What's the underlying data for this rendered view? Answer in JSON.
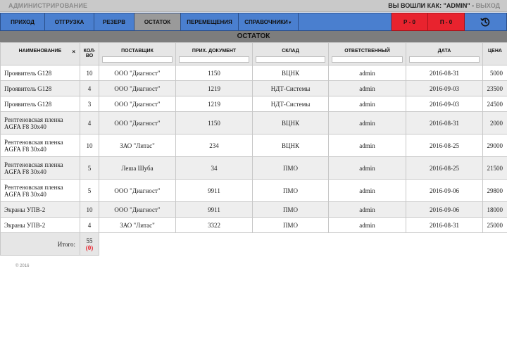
{
  "topbar": {
    "admin_link": "АДМИНИСТРИРОВАНИЕ",
    "login_prefix": "ВЫ ВОШЛИ КАК: \"ADMIN\"",
    "separator": " - ",
    "logout": "ВЫХОД"
  },
  "nav": {
    "items": [
      {
        "label": "ПРИХОД"
      },
      {
        "label": "ОТГРУЗКА"
      },
      {
        "label": "РЕЗЕРВ"
      },
      {
        "label": "ОСТАТОК"
      },
      {
        "label": "ПЕРЕМЕЩЕНИЯ"
      },
      {
        "label": "СПРАВОЧНИКИ"
      }
    ],
    "counter_r": "Р - 0",
    "counter_p": "П - 0",
    "history_icon": "history-icon",
    "active_color": "#9a9a9a",
    "nav_color": "#4a7fcf",
    "alert_color": "#e8232e"
  },
  "section_title": "ОСТАТОК",
  "table": {
    "headers": {
      "name": "НАИМЕНОВАНИЕ",
      "clear": "×",
      "qty": "КОЛ-ВО",
      "supplier": "ПОСТАВЩИК",
      "document": "ПРИХ. ДОКУМЕНТ",
      "warehouse": "СКЛАД",
      "responsible": "ОТВЕТСТВЕННЫЙ",
      "date": "ДАТА",
      "price": "ЦЕНА"
    },
    "rows": [
      {
        "name": "Проявитель G128",
        "qty": "10",
        "supplier": "ООО \"Диагност\"",
        "document": "1150",
        "warehouse": "ВЦНК",
        "responsible": "admin",
        "date": "2016-08-31",
        "price": "5000"
      },
      {
        "name": "Проявитель G128",
        "qty": "4",
        "supplier": "ООО \"Диагност\"",
        "document": "1219",
        "warehouse": "НДТ-Системы",
        "responsible": "admin",
        "date": "2016-09-03",
        "price": "23500"
      },
      {
        "name": "Проявитель G128",
        "qty": "3",
        "supplier": "ООО \"Диагност\"",
        "document": "1219",
        "warehouse": "НДТ-Системы",
        "responsible": "admin",
        "date": "2016-09-03",
        "price": "24500"
      },
      {
        "name": "Рентгеновская пленка AGFA F8 30x40",
        "qty": "4",
        "supplier": "ООО \"Диагност\"",
        "document": "1150",
        "warehouse": "ВЦНК",
        "responsible": "admin",
        "date": "2016-08-31",
        "price": "2000"
      },
      {
        "name": "Рентгеновская пленка AGFA F8 30x40",
        "qty": "10",
        "supplier": "ЗАО \"Литас\"",
        "document": "234",
        "warehouse": "ВЦНК",
        "responsible": "admin",
        "date": "2016-08-25",
        "price": "29000"
      },
      {
        "name": "Рентгеновская пленка AGFA F8 30x40",
        "qty": "5",
        "supplier": "Леша Шуба",
        "document": "34",
        "warehouse": "ПМО",
        "responsible": "admin",
        "date": "2016-08-25",
        "price": "21500"
      },
      {
        "name": "Рентгеновская пленка AGFA F8 30x40",
        "qty": "5",
        "supplier": "ООО \"Диагност\"",
        "document": "9911",
        "warehouse": "ПМО",
        "responsible": "admin",
        "date": "2016-09-06",
        "price": "29800"
      },
      {
        "name": "Экраны УПВ-2",
        "qty": "10",
        "supplier": "ООО \"Диагност\"",
        "document": "9911",
        "warehouse": "ПМО",
        "responsible": "admin",
        "date": "2016-09-06",
        "price": "18000"
      },
      {
        "name": "Экраны УПВ-2",
        "qty": "4",
        "supplier": "ЗАО \"Литас\"",
        "document": "3322",
        "warehouse": "ПМО",
        "responsible": "admin",
        "date": "2016-08-31",
        "price": "25000"
      }
    ],
    "total_label": "Итого:",
    "total_qty": "55",
    "total_reserved": "(0)"
  },
  "footer": "© 2016"
}
